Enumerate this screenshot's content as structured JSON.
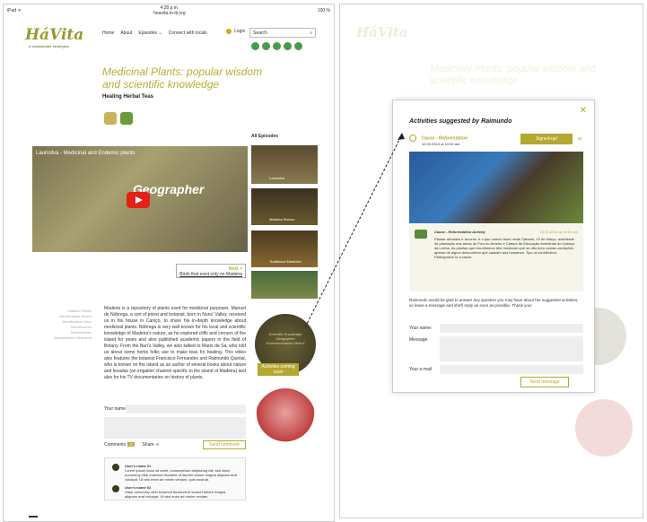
{
  "left": {
    "status": {
      "carrier": "iPad ᯤ",
      "time": "4:28 p.m.",
      "url": "heavita.m-iti.org",
      "battery": "100 %"
    },
    "logo": {
      "name": "HáVita",
      "tag": "a sustainable strategies"
    },
    "nav": [
      "Home",
      "About",
      "Episodes ⌄",
      "Connect with locals"
    ],
    "login": "Login",
    "search_placeholder": "Search",
    "title": "Medicinal Plants: popular wisdom and scientific knowledge",
    "subtitle": "Healing Herbal Teas",
    "video_title": "Laurisilva - Medicinal and Endemic plants",
    "video_overlay": "Geographer",
    "next": {
      "label": "Next >",
      "link": "Birds that exist only on Madeira"
    },
    "episodes_title": "All Episodes",
    "episodes": [
      "Laurisilva",
      "Madeira Rooms",
      "Traditional Medicine",
      ""
    ],
    "names": [
      "Madeira Plants",
      "Beneficiaries Amaro",
      "Beneficiaries Artur",
      "Beneficiaries",
      "Beneficiaries",
      "Beneficiaries Research"
    ],
    "body": "Madeira is a repository of plants used for medicinal purposes. Manuel de Nóbrega, a sort of priest and botanist, born in Nuns' Valley, received us in his house in Caniço, to share his in-depth knowledge about medicinal plants. Nóbrega is very well known for his local and scientific knowledge of Madeira's nature, as he explored cliffs and corners of the island for years and also published academic papers in the field of Botany. From the Nun's Valley, we also talked to Mario de Sá, who told us about some herbs folks use to make teas for healing. This video also features the botanist Francisco Fernandes and Raimundo Quintal, who is known on the island as an author of several books about nature and levadas (an irrigation channel specific to the island of Madeira) and also for his TV documentaries on history of plants.",
    "circle_text": "Scientific Knowledge Geographer Environmentalist Meet it",
    "coming": "Activities coming soon",
    "your_name": "Your name",
    "comments_label": "Comments",
    "comments_count": "(2)",
    "share": "Share",
    "send_comment": "Send comment",
    "comments": [
      {
        "user": "User's name 01",
        "text": "Lorem ipsum dolor sit amet, consectetuer adipiscing elit, sed diam nonummy nibh euismod tincidunt ut laoreet dolore magna aliquam erat volutpat. Ut wisi enim ad minim veniam, quis nostrud."
      },
      {
        "user": "User's name 02",
        "text": "Diam nonummy nibh euismod tincidunt ut laoreet dolore magna aliquam erat volutpat. Ut wisi enim ad minim veniam."
      }
    ]
  },
  "modal": {
    "title": "Activities suggested by Raimundo",
    "cause": "Cause - Reforestation",
    "cause_date": "10.03.2019 at 10:00 am.",
    "signed": "Signed-up!",
    "activity_title": "Cause - Reforestation Activity",
    "activity_date": "10.03.2019 at 10:00 am",
    "activity_text": "Plantar arbustos e árvores, é o que vamos fazer neste Sábado, 10 de Março, actividade de plantação nas áreas do Pico do Areeiro e Campo de Educação Ambiental do Cabeço da Lenha. As plantas que escolhemos têm mostrado que se dão bem nestas condições apesar de algum desconforto que causam aos humanos. Tipo of contribution: Participation in a cause.",
    "raimundo_text": "Raimundo would be glad to answer any question you may have about her suggested activities, so leave a message and she'll reply as soon as possible. Thank you!",
    "your_name": "Your name:",
    "message": "Message",
    "email": "Your e-mail",
    "send": "Send message",
    "close": "✕"
  }
}
